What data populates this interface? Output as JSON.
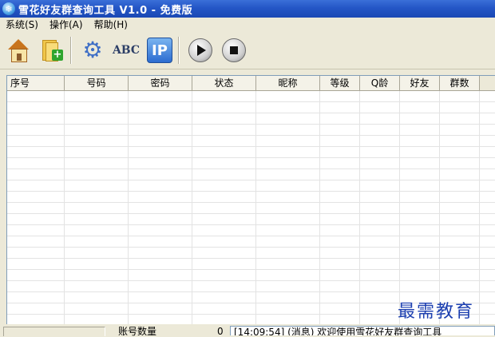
{
  "window": {
    "title": "雪花好友群查询工具 V1.0 - 免费版",
    "icon": "snowflake-icon"
  },
  "menu": [
    {
      "label": "系统(S)"
    },
    {
      "label": "操作(A)"
    },
    {
      "label": "帮助(H)"
    }
  ],
  "toolbar": {
    "abc_label": "ABC",
    "ip_label": "IP",
    "icons": [
      "home-icon",
      "folder-add-icon",
      "gear-icon",
      "abc-icon",
      "ip-icon",
      "play-icon",
      "stop-icon"
    ]
  },
  "table": {
    "columns": [
      "序号",
      "号码",
      "密码",
      "状态",
      "昵称",
      "等级",
      "Q龄",
      "好友",
      "群数"
    ],
    "rows": []
  },
  "watermark": "最需教育",
  "status": {
    "account_label": "账号数量",
    "account_count": "0",
    "log": "[14:09:54] (消息) 欢迎使用雪花好友群查询工具"
  },
  "colors": {
    "titlebar": "#2456c6",
    "chrome": "#ece9d8",
    "watermark": "#1c3fb0"
  }
}
